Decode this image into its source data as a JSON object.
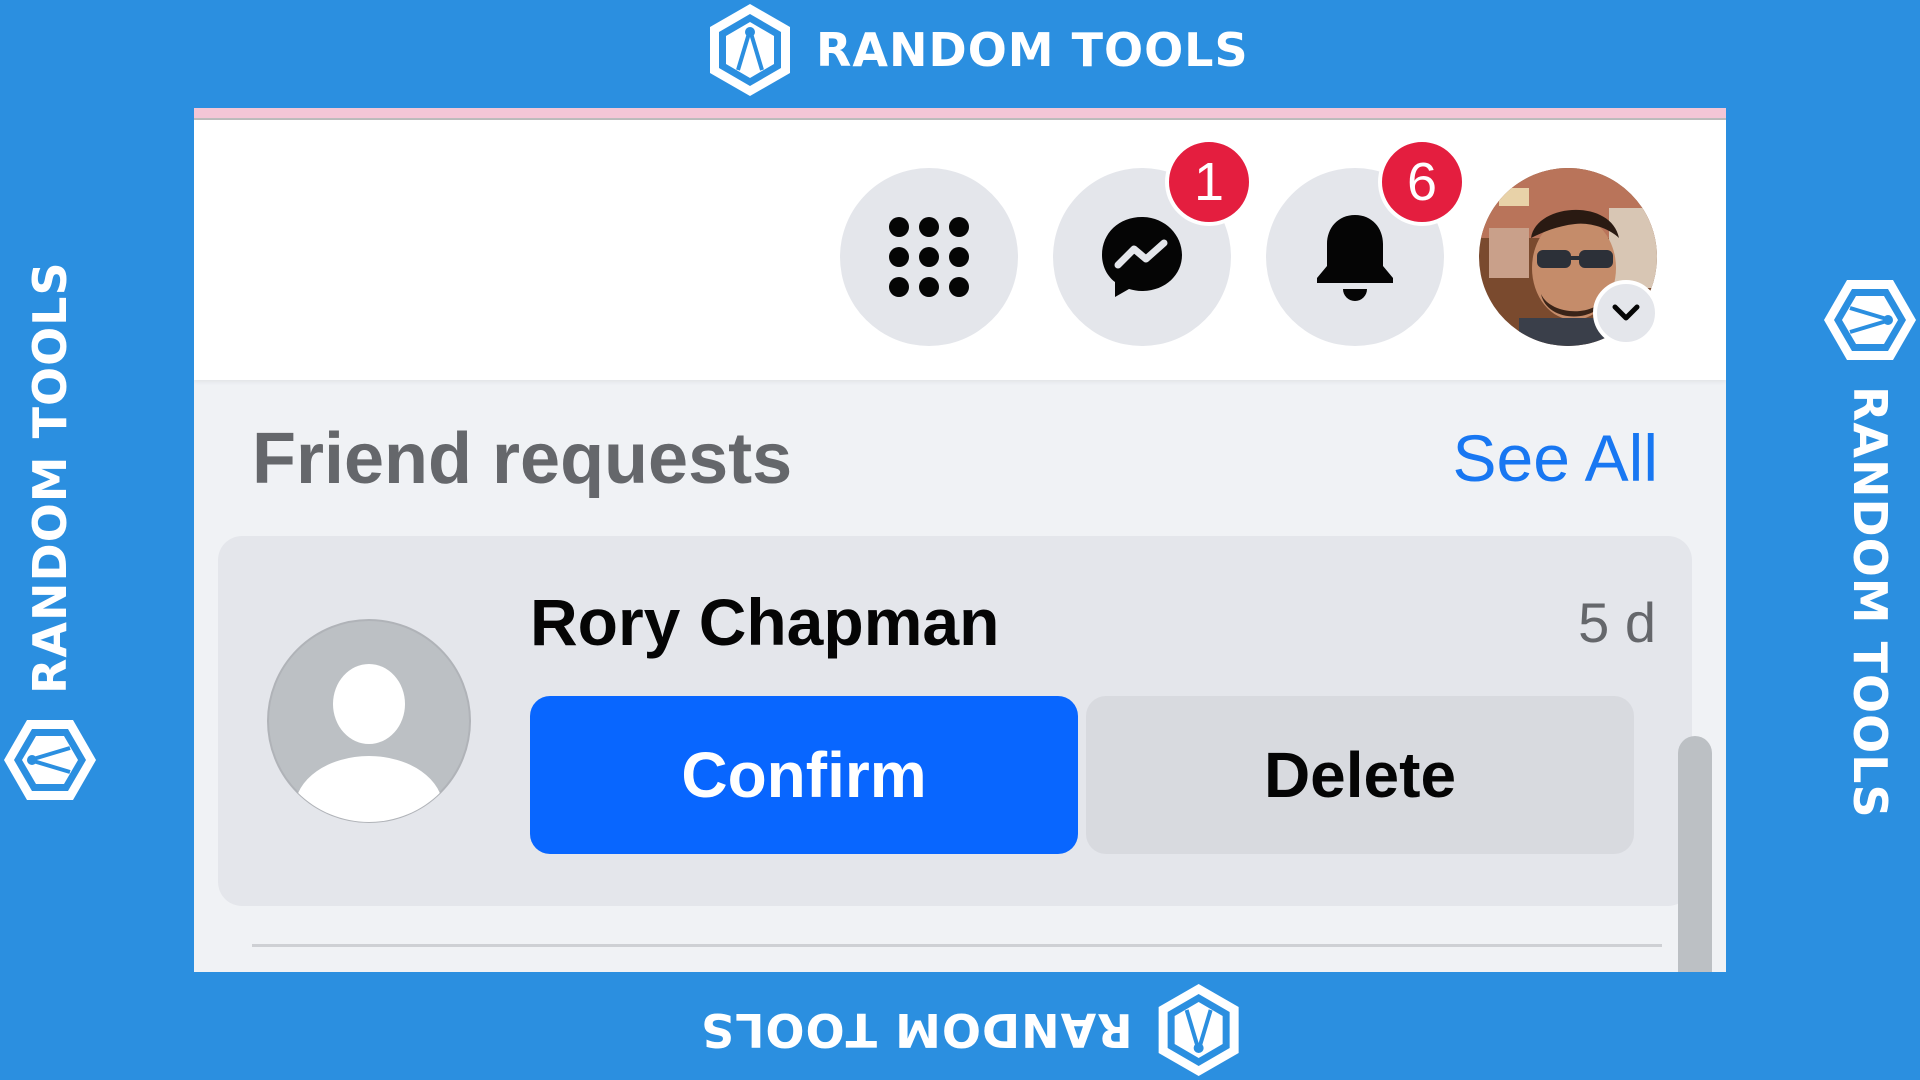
{
  "watermark": {
    "text": "RANDOM TOOLS"
  },
  "topbar": {
    "menu_icon": "grid-icon",
    "messenger_icon": "messenger-icon",
    "messenger_badge": "1",
    "notifications_icon": "bell-icon",
    "notifications_badge": "6",
    "profile_chevron_icon": "chevron-down-icon"
  },
  "friend_requests": {
    "title": "Friend requests",
    "see_all": "See All",
    "items": [
      {
        "name": "Rory Chapman",
        "time": "5 d",
        "confirm_label": "Confirm",
        "delete_label": "Delete"
      }
    ]
  },
  "colors": {
    "frame": "#2b8fe0",
    "confirm": "#0866ff",
    "link": "#1877f2",
    "badge": "#e41e3f"
  }
}
